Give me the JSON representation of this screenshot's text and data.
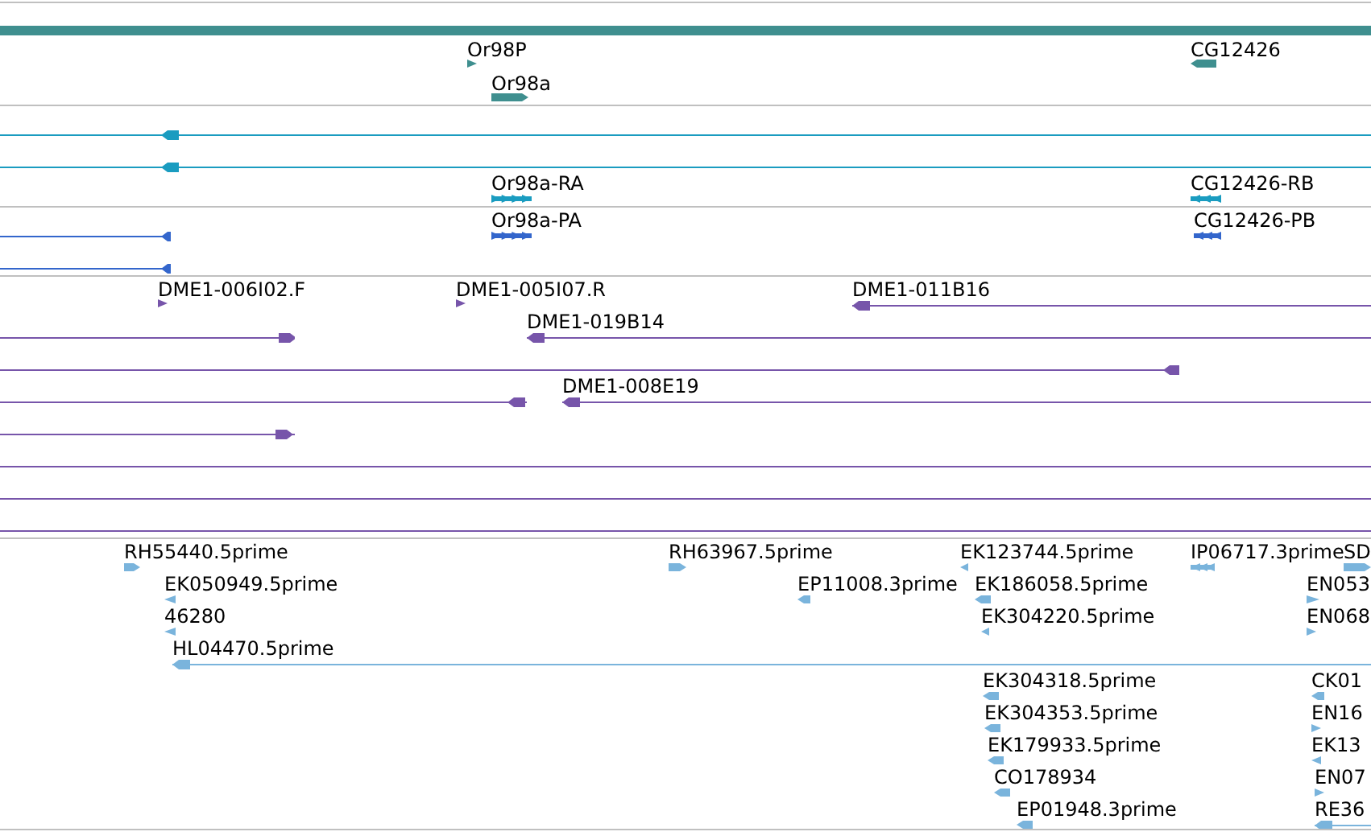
{
  "tracks": [
    {
      "kind": "gene",
      "color": "#3f8f8f",
      "features": [
        {
          "label": "Or98P",
          "kind": "arrow",
          "reverse": false
        },
        {
          "label": "Or98a",
          "kind": "block",
          "reverse": false
        },
        {
          "label": "CG12426",
          "kind": "block",
          "reverse": true
        }
      ]
    },
    {
      "kind": "transcript",
      "color": "#1a9cc0",
      "features": [
        {
          "kind": "line",
          "reverse": true
        },
        {
          "kind": "line",
          "reverse": true
        },
        {
          "label": "Or98a-RA",
          "kind": "multi",
          "reverse": false
        },
        {
          "label": "CG12426-RB",
          "kind": "multi",
          "reverse": true
        }
      ]
    },
    {
      "kind": "protein",
      "color": "#3366cc",
      "features": [
        {
          "kind": "line",
          "reverse": true
        },
        {
          "kind": "line",
          "reverse": true
        },
        {
          "label": "Or98a-PA",
          "kind": "multi",
          "reverse": false
        },
        {
          "label": "CG12426-PB",
          "kind": "multi",
          "reverse": true
        }
      ]
    },
    {
      "kind": "clone",
      "color": "#7755aa",
      "features": [
        {
          "label": "DME1-006I02.F",
          "kind": "arrow",
          "reverse": false
        },
        {
          "label": "DME1-005I07.R",
          "kind": "arrow",
          "reverse": false
        },
        {
          "label": "DME1-011B16",
          "kind": "line",
          "reverse": true
        },
        {
          "label": "DME1-019B14",
          "kind": "line",
          "reverse": true
        },
        {
          "kind": "line",
          "reverse": false
        },
        {
          "kind": "line",
          "reverse": true
        },
        {
          "label": "DME1-008E19",
          "kind": "line",
          "reverse": true
        },
        {
          "kind": "line",
          "reverse": true
        },
        {
          "kind": "line",
          "reverse": false
        },
        {
          "kind": "line"
        },
        {
          "kind": "line"
        },
        {
          "kind": "line"
        }
      ]
    },
    {
      "kind": "est",
      "color": "#7ab4dc",
      "features": [
        {
          "label": "RH55440.5prime",
          "kind": "block",
          "reverse": false
        },
        {
          "label": "RH63967.5prime",
          "kind": "block",
          "reverse": false
        },
        {
          "label": "EK123744.5prime",
          "kind": "arrow",
          "reverse": true
        },
        {
          "label": "IP06717.3prime",
          "kind": "multi",
          "reverse": true
        },
        {
          "label": "SD",
          "kind": "block",
          "reverse": false
        },
        {
          "label": "EK050949.5prime",
          "kind": "arrow",
          "reverse": true
        },
        {
          "label": "EP11008.3prime",
          "kind": "block",
          "reverse": true
        },
        {
          "label": "EK186058.5prime",
          "kind": "block",
          "reverse": true
        },
        {
          "label": "EN053",
          "kind": "arrow",
          "reverse": false
        },
        {
          "label": "46280",
          "kind": "arrow",
          "reverse": true
        },
        {
          "label": "EK304220.5prime",
          "kind": "arrow",
          "reverse": true
        },
        {
          "label": "EN068",
          "kind": "arrow",
          "reverse": false
        },
        {
          "label": "HL04470.5prime",
          "kind": "line",
          "reverse": true
        },
        {
          "label": "EK304318.5prime",
          "kind": "block",
          "reverse": true
        },
        {
          "label": "CK01",
          "kind": "block",
          "reverse": true
        },
        {
          "label": "EK304353.5prime",
          "kind": "block",
          "reverse": true
        },
        {
          "label": "EN16",
          "kind": "arrow",
          "reverse": false
        },
        {
          "label": "EK179933.5prime",
          "kind": "block",
          "reverse": true
        },
        {
          "label": "EK13",
          "kind": "arrow",
          "reverse": true
        },
        {
          "label": "CO178934",
          "kind": "block",
          "reverse": true
        },
        {
          "label": "EN07",
          "kind": "arrow",
          "reverse": false
        },
        {
          "label": "EP01948.3prime",
          "kind": "block",
          "reverse": true
        },
        {
          "label": "RE36",
          "kind": "line",
          "reverse": true
        }
      ]
    }
  ]
}
